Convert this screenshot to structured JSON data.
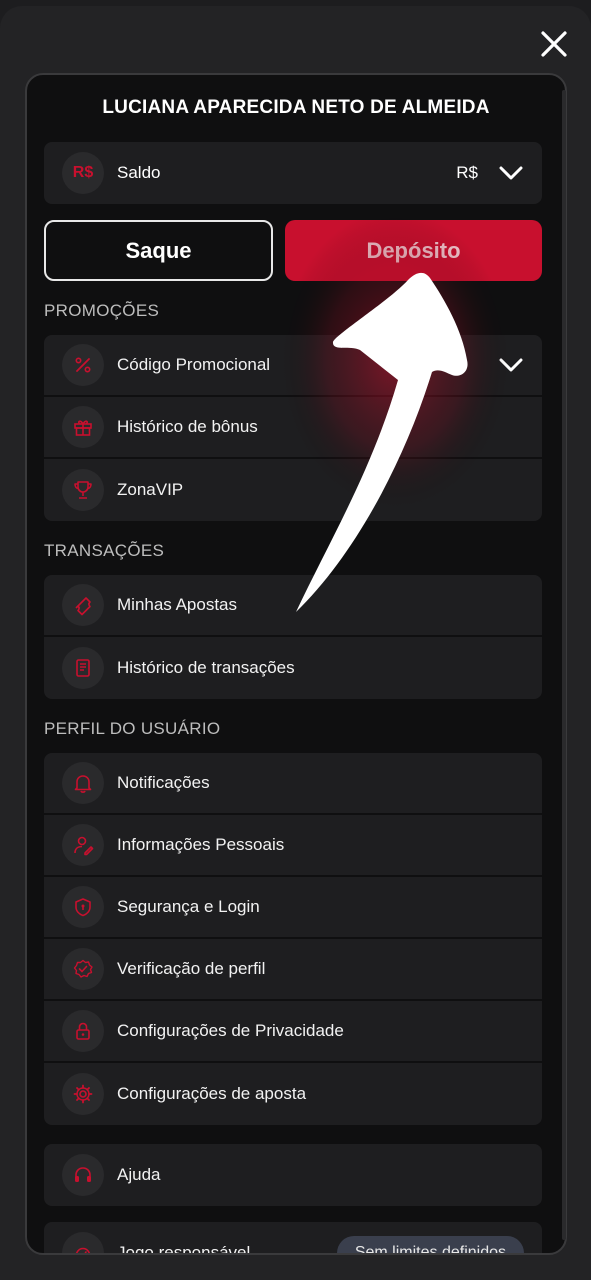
{
  "user": {
    "name": "LUCIANA APARECIDA NETO DE ALMEIDA"
  },
  "balance": {
    "icon_text": "R$",
    "label": "Saldo",
    "currency": "R$"
  },
  "actions": {
    "withdraw_label": "Saque",
    "deposit_label": "Depósito"
  },
  "sections": {
    "promotions": {
      "title": "PROMOÇÕES",
      "items": [
        {
          "label": "Código Promocional",
          "icon": "percent-icon"
        },
        {
          "label": "Histórico de bônus",
          "icon": "gift-icon"
        },
        {
          "label": "ZonaVIP",
          "icon": "trophy-icon"
        }
      ]
    },
    "transactions": {
      "title": "TRANSAÇÕES",
      "items": [
        {
          "label": "Minhas Apostas",
          "icon": "ticket-icon"
        },
        {
          "label": "Histórico de transações",
          "icon": "receipt-icon"
        }
      ]
    },
    "profile": {
      "title": "PERFIL DO USUÁRIO",
      "items": [
        {
          "label": "Notificações",
          "icon": "bell-icon"
        },
        {
          "label": "Informações Pessoais",
          "icon": "user-edit-icon"
        },
        {
          "label": "Segurança e Login",
          "icon": "shield-icon"
        },
        {
          "label": "Verificação de perfil",
          "icon": "verified-badge-icon"
        },
        {
          "label": "Configurações de Privacidade",
          "icon": "lock-icon"
        },
        {
          "label": "Configurações de aposta",
          "icon": "gear-icon"
        }
      ]
    }
  },
  "help": {
    "label": "Ajuda",
    "icon": "headset-icon"
  },
  "responsible": {
    "label": "Jogo responsável",
    "badge": "Sem limites definidos",
    "icon": "gauge-icon"
  },
  "colors": {
    "accent": "#c8102e",
    "panel": "#0f0f10",
    "card": "#1e1e20"
  }
}
